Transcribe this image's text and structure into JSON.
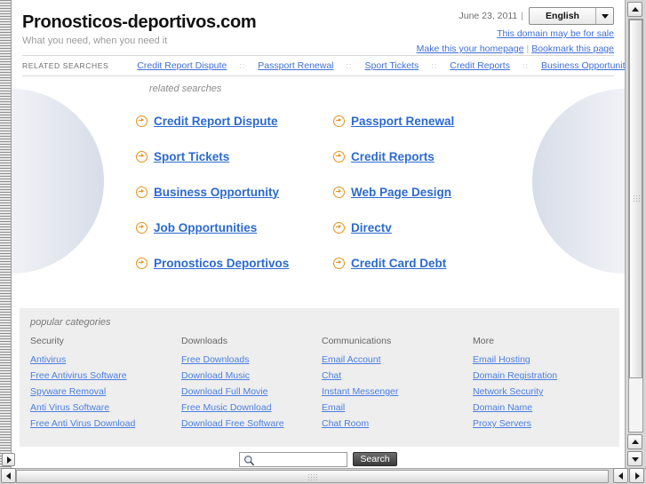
{
  "header": {
    "site_title": "Pronosticos-deportivos.com",
    "tagline": "What you need, when you need it",
    "date": "June 23, 2011",
    "pipe": "|",
    "language_selected": "English",
    "for_sale_link": "This domain may be for sale",
    "homepage_link": "Make this your homepage",
    "link_separator": "|",
    "bookmark_link": "Bookmark this page"
  },
  "related_bar": {
    "caption": "RELATED SEARCHES",
    "dot": "::",
    "items": [
      "Credit Report Dispute",
      "Passport Renewal",
      "Sport Tickets",
      "Credit Reports",
      "Business Opportunity"
    ]
  },
  "hero": {
    "heading": "related searches",
    "links": [
      "Credit Report Dispute",
      "Passport Renewal",
      "Sport Tickets",
      "Credit Reports",
      "Business Opportunity",
      "Web Page Design",
      "Job Opportunities",
      "Directv",
      "Pronosticos Deportivos",
      "Credit Card Debt"
    ]
  },
  "categories": {
    "heading": "popular categories",
    "columns": [
      {
        "title": "Security",
        "links": [
          "Antivirus",
          "Free Antivirus Software",
          "Spyware Removal",
          "Anti Virus Software",
          "Free Anti Virus Download"
        ]
      },
      {
        "title": "Downloads",
        "links": [
          "Free Downloads",
          "Download Music",
          "Download Full Movie",
          "Free Music Download",
          "Download Free Software"
        ]
      },
      {
        "title": "Communications",
        "links": [
          "Email Account",
          "Chat",
          "Instant Messenger",
          "Email",
          "Chat Room"
        ]
      },
      {
        "title": "More",
        "links": [
          "Email Hosting",
          "Domain Registration",
          "Network Security",
          "Domain Name",
          "Proxy Servers"
        ]
      }
    ]
  },
  "search": {
    "value": "",
    "placeholder": "",
    "button_label": "Search"
  },
  "colors": {
    "link_blue": "#3f6fd8",
    "hero_link_blue": "#2b6ad0",
    "bullet_orange": "#e8921b",
    "category_bg": "#eeeeee"
  }
}
